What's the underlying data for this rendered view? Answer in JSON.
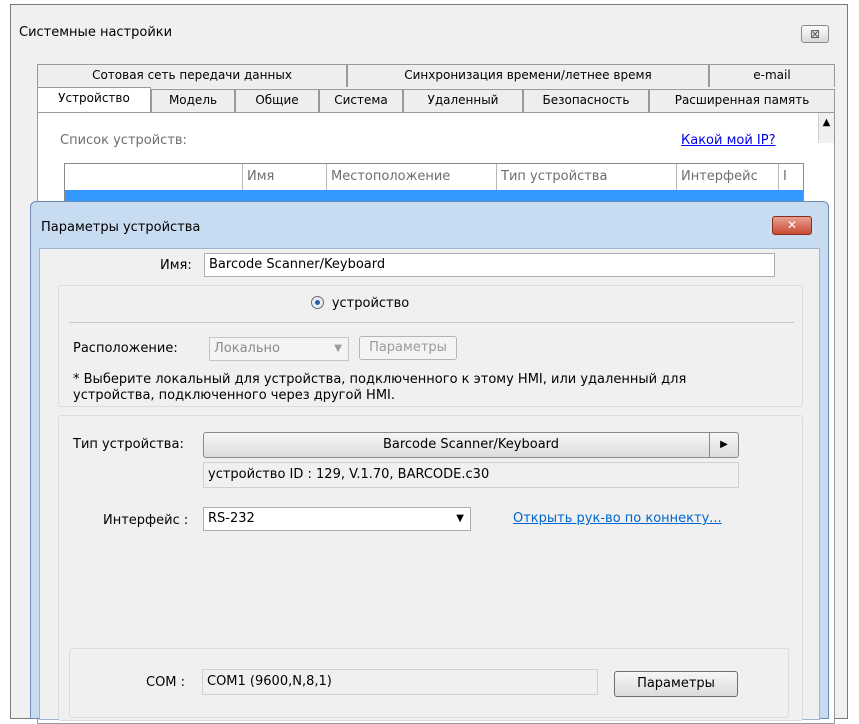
{
  "outer_window": {
    "title": "Системные настройки",
    "close_glyph": "⊠",
    "tabs_row1": [
      "Сотовая сеть передачи данных",
      "Синхронизация времени/летнее время",
      "e-mail"
    ],
    "tabs_row2": [
      "Устройство",
      "Модель",
      "Общие",
      "Система",
      "Удаленный",
      "Безопасность",
      "Расширенная память"
    ],
    "active_tab": "Устройство",
    "device_list_label": "Список устройств:",
    "my_ip_link": "Какой мой IP?",
    "table_headers": [
      "",
      "Имя",
      "Местоположение",
      "Тип устройства",
      "Интерфейс",
      "I"
    ]
  },
  "device_dialog": {
    "title": "Параметры устройства",
    "close_glyph": "✕",
    "name_label": "Имя:",
    "name_value": "Barcode Scanner/Keyboard",
    "radio_label": "устройство",
    "location_label": "Расположение:",
    "location_value": "Локально",
    "location_params_button": "Параметры",
    "note": "* Выберите локальный для устройства, подключенного к этому HMI, или удаленный для устройства, подключенного через другой HMI.",
    "device_type_label": "Тип устройства:",
    "device_type_value": "Barcode Scanner/Keyboard",
    "device_info": "устройство ID : 129, V.1.70, BARCODE.c30",
    "interface_label": "Интерфейс :",
    "interface_value": "RS-232",
    "connector_link": "Открыть рук-во по коннекту...",
    "com_label": "COM :",
    "com_value": "COM1 (9600,N,8,1)",
    "com_params_button": "Параметры"
  }
}
